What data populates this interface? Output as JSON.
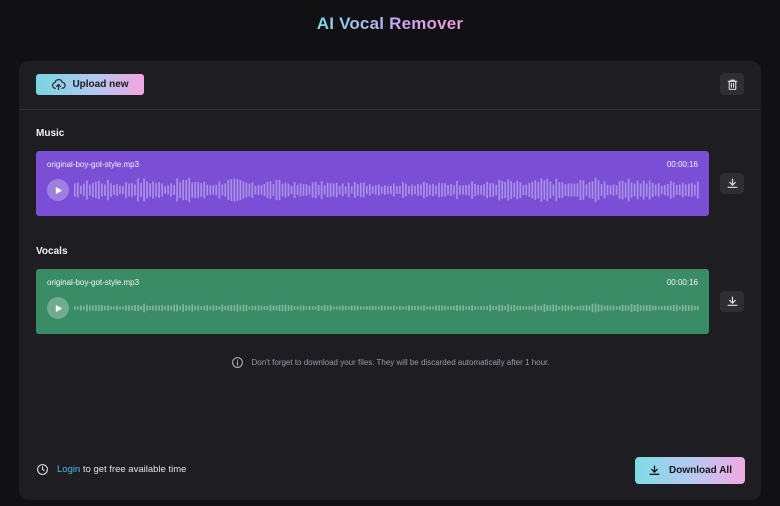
{
  "app": {
    "title": "AI Vocal Remover"
  },
  "toolbar": {
    "upload_label": "Upload new"
  },
  "tracks": [
    {
      "section": "Music",
      "filename": "original-boy-got-style.mp3",
      "duration": "00:00:16",
      "color": "#7a4fd6"
    },
    {
      "section": "Vocals",
      "filename": "original-boy-got-style.mp3",
      "duration": "00:00:16",
      "color": "#3a8c66"
    }
  ],
  "notice": {
    "text": "Don't forget to download your files. They will be discarded automatically after 1 hour."
  },
  "footer": {
    "login_link": "Login",
    "login_suffix": "to get free available time",
    "download_all_label": "Download All"
  },
  "icons": [
    "upload-cloud-icon",
    "trash-icon",
    "play-icon",
    "download-icon",
    "info-icon",
    "clock-icon"
  ]
}
